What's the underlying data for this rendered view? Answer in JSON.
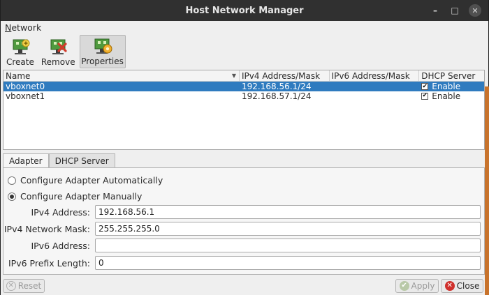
{
  "window": {
    "title": "Host Network Manager"
  },
  "menu": {
    "network": "Network"
  },
  "toolbar": {
    "create": "Create",
    "remove": "Remove",
    "properties": "Properties"
  },
  "table": {
    "headers": [
      "Name",
      "IPv4 Address/Mask",
      "IPv6 Address/Mask",
      "DHCP Server"
    ],
    "rows": [
      {
        "name": "vboxnet0",
        "ipv4": "192.168.56.1/24",
        "ipv6": "",
        "dhcp": "Enable",
        "dhcp_checked": true,
        "selected": true
      },
      {
        "name": "vboxnet1",
        "ipv4": "192.168.57.1/24",
        "ipv6": "",
        "dhcp": "Enable",
        "dhcp_checked": true,
        "selected": false
      }
    ]
  },
  "tabs": {
    "adapter": "Adapter",
    "dhcp": "DHCP Server"
  },
  "adapter": {
    "auto_label": "Configure Adapter Automatically",
    "manual_label": "Configure Adapter Manually",
    "mode": "manual",
    "ipv4_address_label": "IPv4 Address:",
    "ipv4_address_value": "192.168.56.1",
    "ipv4_mask_label": "IPv4 Network Mask:",
    "ipv4_mask_value": "255.255.255.0",
    "ipv6_address_label": "IPv6 Address:",
    "ipv6_address_value": "",
    "ipv6_prefix_label": "IPv6 Prefix Length:",
    "ipv6_prefix_value": "0"
  },
  "buttons": {
    "reset": "Reset",
    "apply": "Apply",
    "close": "Close"
  },
  "colors": {
    "selection": "#2f7bbf",
    "titlebar": "#303030",
    "close_icon": "#d0312d",
    "apply_icon": "#7fae52"
  },
  "icons": [
    "network-create-icon",
    "network-remove-icon",
    "network-properties-icon",
    "reset-icon",
    "apply-icon",
    "close-icon"
  ]
}
